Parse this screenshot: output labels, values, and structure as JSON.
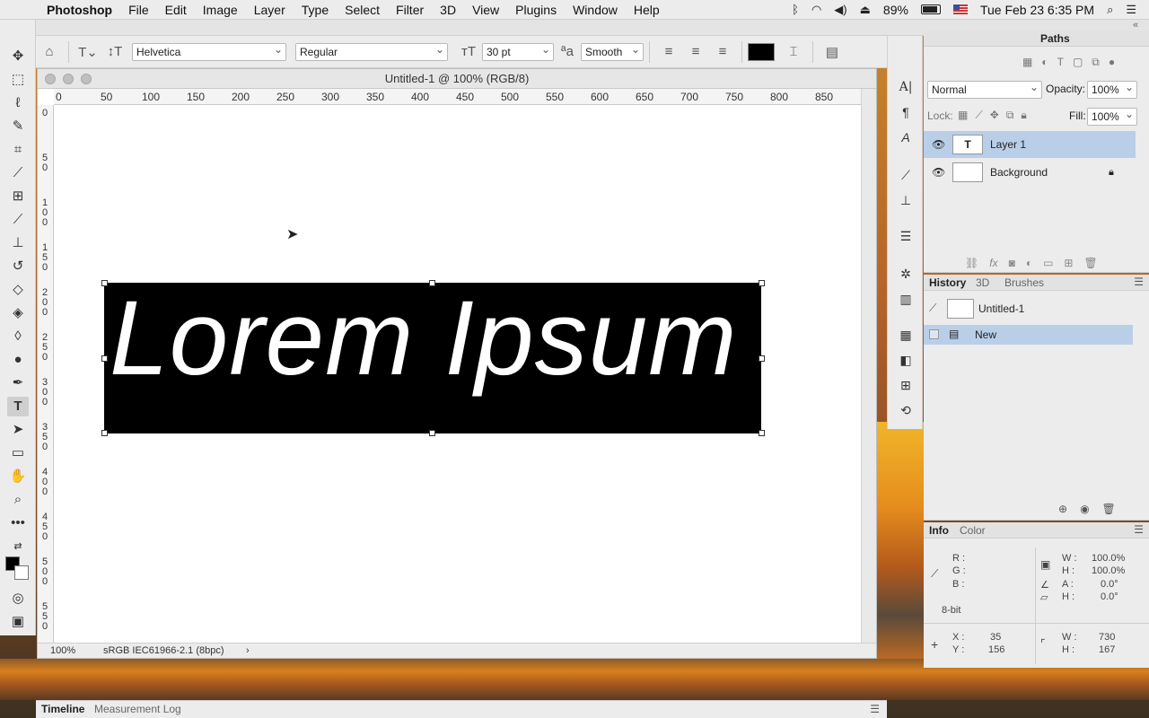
{
  "menubar": {
    "app": "Photoshop",
    "items": [
      "File",
      "Edit",
      "Image",
      "Layer",
      "Type",
      "Select",
      "Filter",
      "3D",
      "View",
      "Plugins",
      "Window",
      "Help"
    ],
    "battery": "89%",
    "datetime": "Tue Feb 23  6:35 PM"
  },
  "options": {
    "font_family": "Helvetica",
    "font_style": "Regular",
    "font_size": "30 pt",
    "antialias": "Smooth",
    "text_color": "#000000"
  },
  "document": {
    "title": "Untitled-1 @ 100% (RGB/8)",
    "ruler_h": [
      "0",
      "50",
      "100",
      "150",
      "200",
      "250",
      "300",
      "350",
      "400",
      "450",
      "500",
      "550",
      "600",
      "650",
      "700",
      "750",
      "800",
      "850"
    ],
    "ruler_v": [
      "0",
      "5 0",
      "1 0 0",
      "1 5 0",
      "2 0 0",
      "2 5 0",
      "3 0 0",
      "3 5 0",
      "4 0 0",
      "4 5 0",
      "5 0 0",
      "5 5 0"
    ],
    "text_content": "Lorem Ipsum",
    "zoom": "100%",
    "profile": "sRGB IEC61966-2.1 (8bpc)"
  },
  "layers_panel": {
    "tab_paths": "Paths",
    "blend_mode": "Normal",
    "opacity_label": "Opacity:",
    "opacity": "100%",
    "lock_label": "Lock:",
    "fill_label": "Fill:",
    "fill": "100%",
    "layers": [
      {
        "name": "Layer 1",
        "thumb": "T",
        "selected": true
      },
      {
        "name": "Background",
        "thumb": "",
        "selected": false
      }
    ]
  },
  "history_panel": {
    "tabs": [
      "History",
      "3D",
      "Brushes"
    ],
    "snapshot": "Untitled-1",
    "states": [
      "New"
    ]
  },
  "info_panel": {
    "tabs": [
      "Info",
      "Color"
    ],
    "r": "R :",
    "g": "G :",
    "b": "B :",
    "bitdepth": "8-bit",
    "w_pct": "100.0%",
    "h_pct": "100.0%",
    "angle": "0.0°",
    "skew": "0.0°",
    "x": "35",
    "y": "156",
    "w": "730",
    "h": "167"
  },
  "bottom": {
    "tabs": [
      "Timeline",
      "Measurement Log"
    ]
  }
}
